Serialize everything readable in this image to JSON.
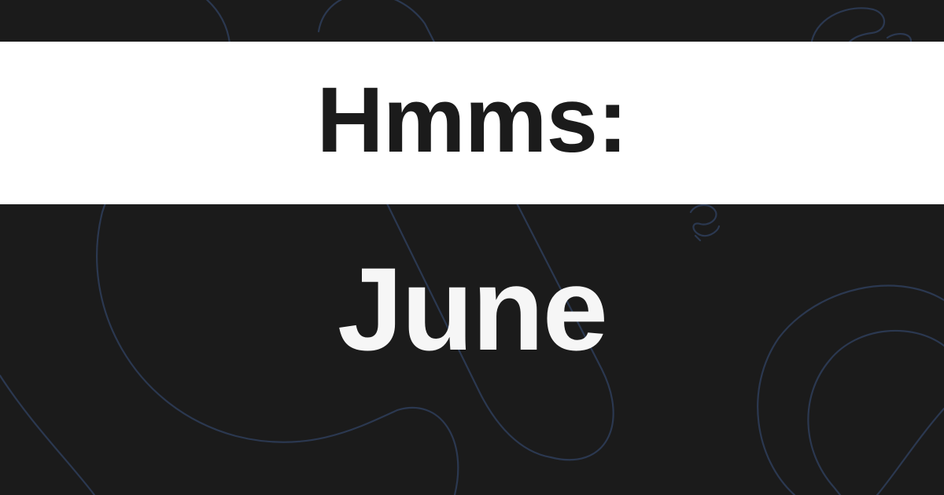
{
  "banner": {
    "headline": "Hmms:"
  },
  "main": {
    "subject": "June"
  },
  "colors": {
    "background": "#1b1b1b",
    "banner_background": "#ffffff",
    "headline_text": "#1b1b1b",
    "subject_text": "#f6f6f6",
    "decorative_lines": "#2b3850"
  }
}
